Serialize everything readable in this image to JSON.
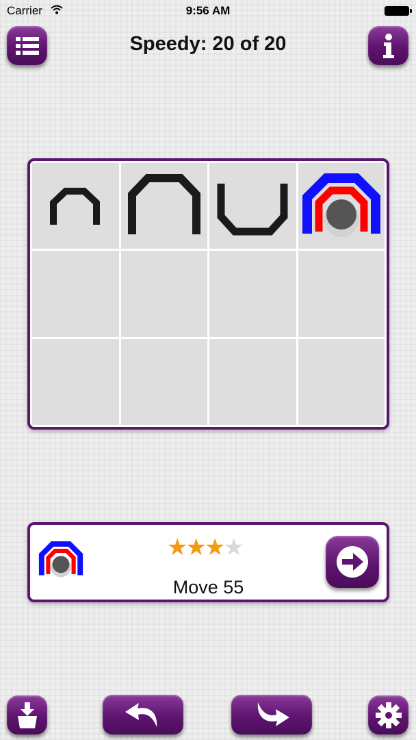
{
  "status_bar": {
    "carrier": "Carrier",
    "time": "9:56 AM"
  },
  "header": {
    "title": "Speedy: 20 of 20",
    "menu_icon": "list-icon",
    "info_icon": "info-icon"
  },
  "board": {
    "rows": 3,
    "cols": 4,
    "pieces": [
      {
        "cell": "r1c1",
        "shape": "small-arch",
        "color": "#1a1a1a"
      },
      {
        "cell": "r1c2",
        "shape": "large-arch",
        "color": "#1a1a1a"
      },
      {
        "cell": "r1c3",
        "shape": "cup",
        "color": "#1a1a1a"
      },
      {
        "cell": "r1c4",
        "shape": "stacked-target",
        "colors": [
          "#1010ff",
          "#ff0000",
          "#555555"
        ]
      }
    ]
  },
  "status_panel": {
    "rating": 3,
    "rating_max": 4,
    "move_text": "Move 55",
    "next_icon": "arrow-right-icon"
  },
  "toolbar": {
    "icons": [
      "download-icon",
      "undo-icon",
      "redo-icon",
      "gear-icon"
    ]
  },
  "colors": {
    "accent": "#5e1470",
    "border": "#5a1670",
    "star": "#f39a12"
  }
}
